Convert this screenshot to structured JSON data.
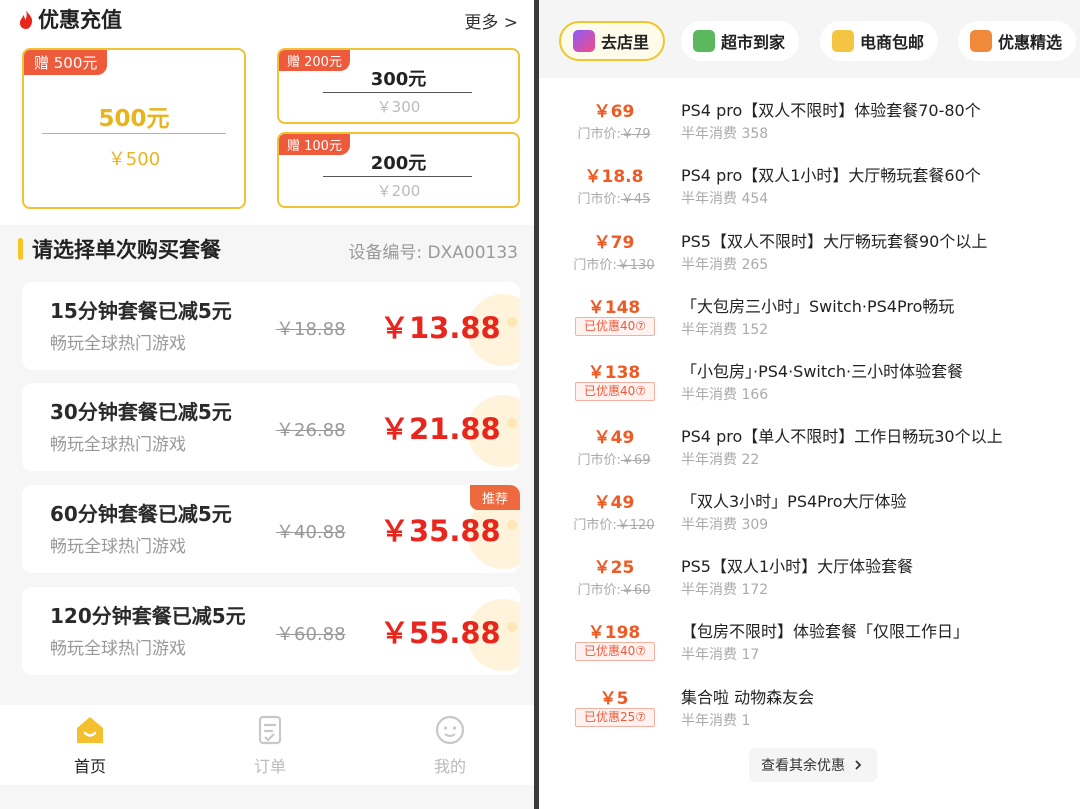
{
  "left": {
    "section_title": "优惠充值",
    "more": "更多 >",
    "cards": [
      {
        "gift": "赠 500元",
        "amount": "500元",
        "price": "￥500"
      },
      {
        "gift": "赠 200元",
        "amount": "300元",
        "price": "￥300"
      },
      {
        "gift": "赠 100元",
        "amount": "200元",
        "price": "￥200"
      }
    ],
    "package_title": "请选择单次购买套餐",
    "device_no": "设备编号: DXA00133",
    "packages": [
      {
        "name": "15分钟套餐已减5元",
        "sub": "畅玩全球热门游戏",
        "orig": "￥18.88",
        "price": "￥13.88"
      },
      {
        "name": "30分钟套餐已减5元",
        "sub": "畅玩全球热门游戏",
        "orig": "￥26.88",
        "price": "￥21.88"
      },
      {
        "name": "60分钟套餐已减5元",
        "sub": "畅玩全球热门游戏",
        "orig": "￥40.88",
        "price": "￥35.88",
        "tag": "推荐"
      },
      {
        "name": "120分钟套餐已减5元",
        "sub": "畅玩全球热门游戏",
        "orig": "￥60.88",
        "price": "￥55.88"
      }
    ],
    "tabs": [
      {
        "label": "首页",
        "icon": "home-icon",
        "active": true
      },
      {
        "label": "订单",
        "icon": "order-icon",
        "active": false
      },
      {
        "label": "我的",
        "icon": "profile-icon",
        "active": false
      }
    ]
  },
  "right": {
    "chips": [
      {
        "label": "去店里",
        "icon": "store-icon",
        "active": true
      },
      {
        "label": "超市到家",
        "icon": "basket-icon",
        "active": false
      },
      {
        "label": "电商包邮",
        "icon": "delivery-icon",
        "active": false
      },
      {
        "label": "优惠精选",
        "icon": "bag-icon",
        "active": false
      }
    ],
    "store_price_label": "门市价:",
    "deals": [
      {
        "price": "￥69",
        "store_price": "￥79",
        "title": "PS4 pro【双人不限时】体验套餐70-80个",
        "sales": "半年消费 358"
      },
      {
        "price": "￥18.8",
        "store_price": "￥45",
        "title": "PS4 pro【双人1小时】大厅畅玩套餐60个",
        "sales": "半年消费 454"
      },
      {
        "price": "￥79",
        "store_price": "￥130",
        "title": "PS5【双人不限时】大厅畅玩套餐90个以上",
        "sales": "半年消费 265"
      },
      {
        "price": "￥148",
        "badge": "已优惠40⑦",
        "title": "「大包房三小时」Switch·PS4Pro畅玩",
        "sales": "半年消费 152"
      },
      {
        "price": "￥138",
        "badge": "已优惠40⑦",
        "title": "「小包房」·PS4·Switch·三小时体验套餐",
        "sales": "半年消费 166"
      },
      {
        "price": "￥49",
        "store_price": "￥69",
        "title": "PS4 pro【单人不限时】工作日畅玩30个以上",
        "sales": "半年消费 22"
      },
      {
        "price": "￥49",
        "store_price": "￥120",
        "title": "「双人3小时」PS4Pro大厅体验",
        "sales": "半年消费 309"
      },
      {
        "price": "￥25",
        "store_price": "￥60",
        "title": "PS5【双人1小时】大厅体验套餐",
        "sales": "半年消费 172"
      },
      {
        "price": "￥198",
        "badge": "已优惠40⑦",
        "title": "【包房不限时】体验套餐「仅限工作日」",
        "sales": "半年消费 17"
      },
      {
        "price": "￥5",
        "badge": "已优惠25⑦",
        "title": "集合啦 动物森友会",
        "sales": "半年消费 1"
      }
    ],
    "see_more": "查看其余优惠"
  },
  "colors": {
    "accent": "#f1c233",
    "price_red": "#e8261d",
    "deal_orange": "#ee5a24",
    "gift_red": "#ee5b3c"
  }
}
